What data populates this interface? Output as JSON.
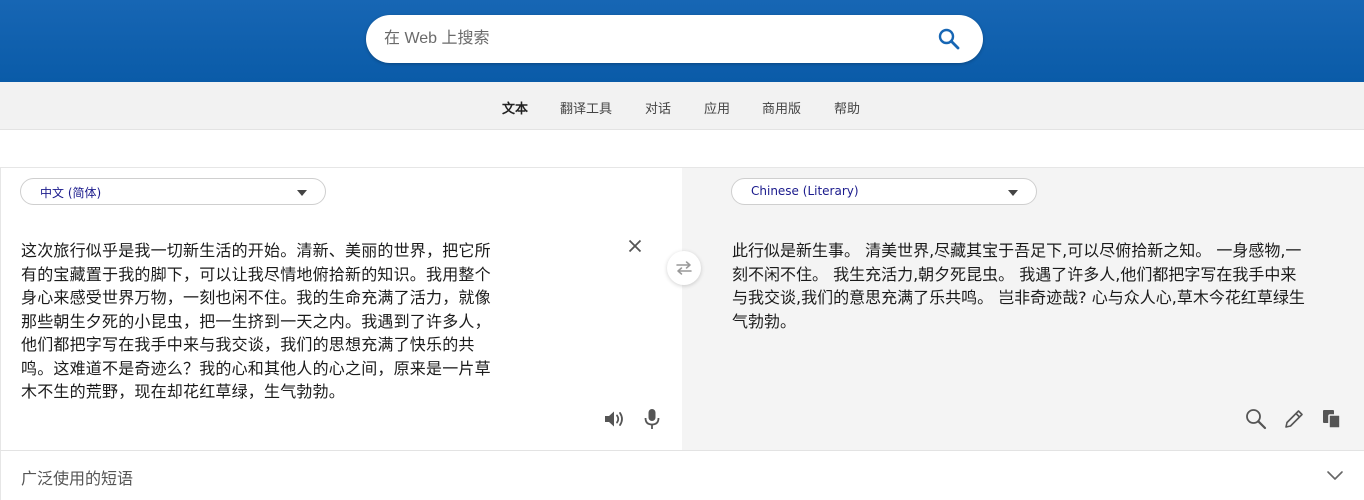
{
  "search": {
    "placeholder": "在 Web 上搜索",
    "value": ""
  },
  "nav": {
    "items": [
      {
        "label": "文本",
        "active": true
      },
      {
        "label": "翻译工具",
        "active": false
      },
      {
        "label": "对话",
        "active": false
      },
      {
        "label": "应用",
        "active": false
      },
      {
        "label": "商用版",
        "active": false
      },
      {
        "label": "帮助",
        "active": false
      }
    ]
  },
  "translator": {
    "source_language": "中文 (简体)",
    "target_language": "Chinese (Literary)",
    "source_lines": [
      "这次旅行似乎是我一切新生活的开始。清新、美丽的世界，把它所",
      "有的宝藏置于我的脚下，可以让我尽情地俯拾新的知识。我用整个",
      "身心来感受世界万物，一刻也闲不住。我的生命充满了活力，就像",
      "那些朝生夕死的小昆虫，把一生挤到一天之内。我遇到了许多人，",
      "他们都把字写在我手中来与我交谈，我们的思想充满了快乐的共",
      "鸣。这难道不是奇迹么？我的心和其他人的心之间，原来是一片草",
      "木不生的荒野，现在却花红草绿，生气勃勃。"
    ],
    "target_lines": [
      "此行似是新生事。 清美世界,尽藏其宝于吾足下,可以尽俯拾新之知。 一身感物,一",
      "刻不闲不住。 我生充活力,朝夕死昆虫。 我遇了许多人,他们都把字写在我手中来",
      "与我交谈,我们的意思充满了乐共鸣。 岂非奇迹哉? 心与众人心,草木今花红草绿生",
      "气勃勃。"
    ]
  },
  "phrases": {
    "label": "广泛使用的短语"
  },
  "colors": {
    "header_bg": "#0b5ea9",
    "nav_bg": "#f2f2f2",
    "target_panel_bg": "#f4f4f4",
    "search_icon": "#1766b4",
    "language_label": "#1a1a8c"
  },
  "icons": {
    "search": "search-icon",
    "clear": "close-icon",
    "swap": "swap-arrows-icon",
    "speaker": "speaker-icon",
    "microphone": "microphone-icon",
    "lookup": "magnifier-icon",
    "edit": "pencil-icon",
    "copy": "copy-icon",
    "expand": "chevron-down-icon"
  }
}
